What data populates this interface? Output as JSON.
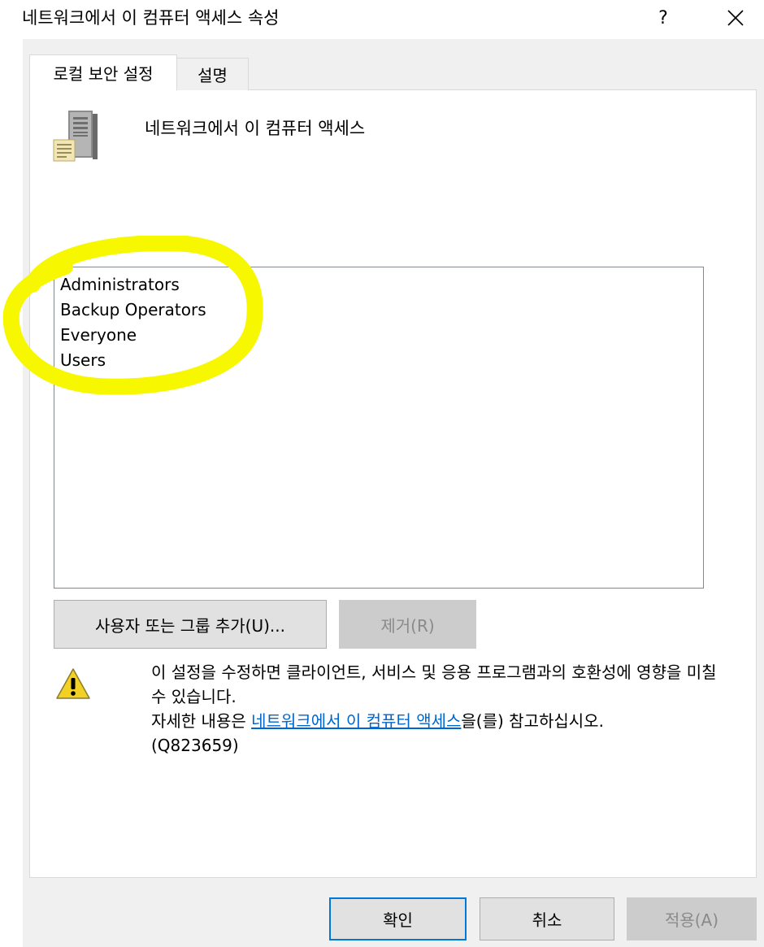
{
  "window": {
    "title": "네트워크에서 이 컴퓨터 액세스 속성",
    "help_label": "?"
  },
  "tabs": [
    {
      "label": "로컬 보안 설정",
      "selected": true
    },
    {
      "label": "설명",
      "selected": false
    }
  ],
  "policy": {
    "name": "네트워크에서 이 컴퓨터 액세스",
    "icon": "server-policy-icon"
  },
  "members": [
    "Administrators",
    "Backup Operators",
    "Everyone",
    "Users"
  ],
  "buttons": {
    "add_label": "사용자 또는 그룹 추가(U)...",
    "remove_label": "제거(R)",
    "ok_label": "확인",
    "cancel_label": "취소",
    "apply_label": "적용(A)"
  },
  "warning": {
    "icon": "warning-icon",
    "line1": "이 설정을 수정하면 클라이언트, 서비스 및 응용 프로그램과의 호환성에 영향을 미칠 수 있습니다.",
    "details_prefix": "자세한 내용은 ",
    "link_text": "네트워크에서 이 컴퓨터 액세스",
    "details_suffix": "을(를) 참고하십시오.",
    "kb_ref": "(Q823659)"
  },
  "colors": {
    "dialog_bg": "#f0f0f0",
    "link": "#0066cc",
    "focus_border": "#0078d7",
    "highlight_marker": "#f7f700"
  }
}
